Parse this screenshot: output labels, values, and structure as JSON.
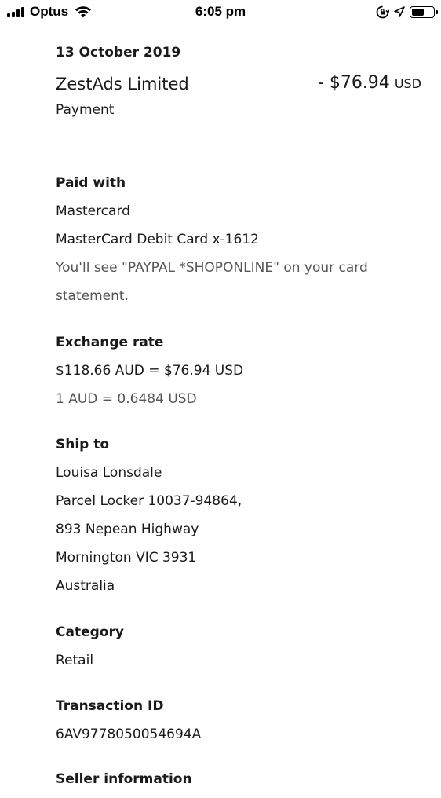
{
  "status_bar": {
    "carrier": "Optus",
    "time": "6:05 pm",
    "battery_level": 0.6
  },
  "transaction": {
    "date": "13 October 2019",
    "merchant": "ZestAds Limited",
    "amount": "- $76.94",
    "currency": "USD",
    "type": "Payment"
  },
  "paid_with": {
    "title": "Paid with",
    "method": "Mastercard",
    "card": "MasterCard Debit Card x-1612",
    "statement_note": "You'll see \"PAYPAL *SHOPONLINE\" on your card statement."
  },
  "exchange_rate": {
    "title": "Exchange rate",
    "conversion": "$118.66 AUD = $76.94 USD",
    "rate": "1 AUD = 0.6484 USD"
  },
  "ship_to": {
    "title": "Ship to",
    "name": "Louisa Lonsdale",
    "line1": "Parcel Locker 10037-94864,",
    "line2": "893 Nepean Highway",
    "line3": "Mornington VIC 3931",
    "country": "Australia"
  },
  "category": {
    "title": "Category",
    "value": "Retail"
  },
  "transaction_id": {
    "title": "Transaction ID",
    "value": "6AV9778050054694A"
  },
  "seller_info": {
    "title": "Seller information"
  }
}
